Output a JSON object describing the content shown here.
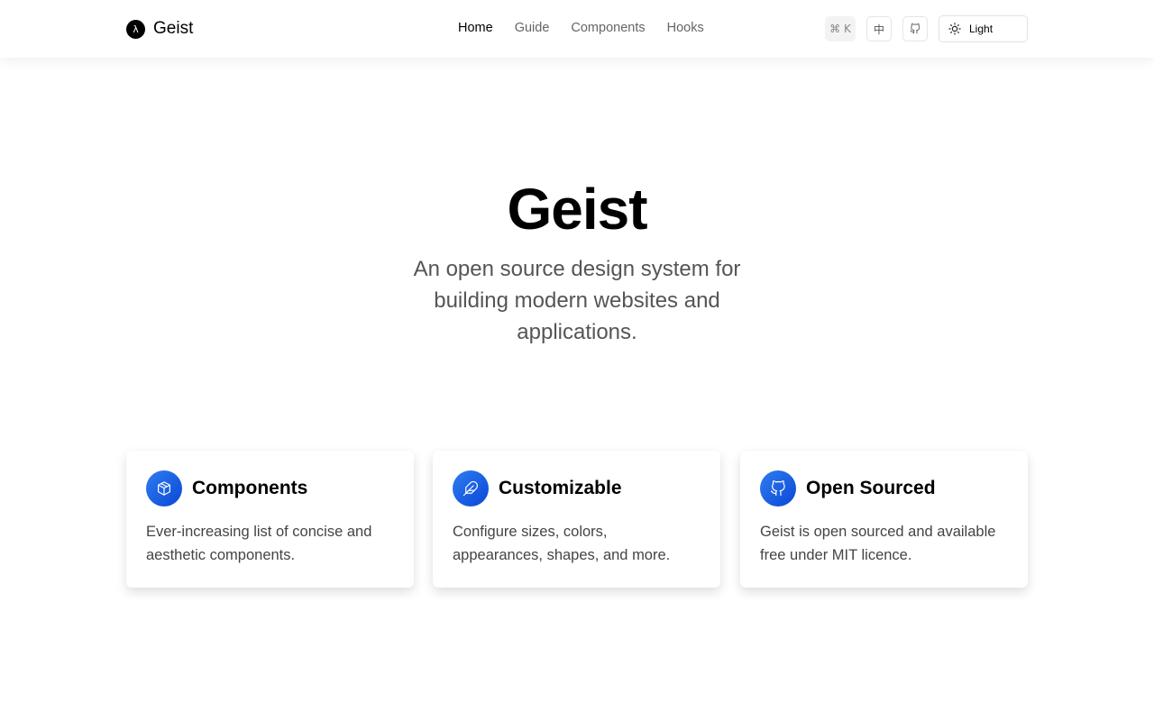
{
  "header": {
    "logo_glyph": "λ",
    "logo_text": "Geist",
    "nav": [
      "Home",
      "Guide",
      "Components",
      "Hooks"
    ],
    "active_nav": "Home",
    "search_shortcut": "⌘ K",
    "language_label": "中",
    "github_icon": "github-icon",
    "theme": {
      "icon": "sun-icon",
      "label": "Light"
    }
  },
  "hero": {
    "title": "Geist",
    "subtitle": "An open source design system for building modern websites and applications."
  },
  "features": [
    {
      "icon": "package-icon",
      "title": "Components",
      "description": "Ever-increasing list of concise and aesthetic components."
    },
    {
      "icon": "feather-icon",
      "title": "Customizable",
      "description": "Configure sizes, colors, appearances, shapes, and more."
    },
    {
      "icon": "github-icon",
      "title": "Open Sourced",
      "description": "Geist is open sourced and available free under MIT licence."
    }
  ],
  "colors": {
    "accent": "#0a47d6",
    "accent_light": "#2f7df0"
  }
}
